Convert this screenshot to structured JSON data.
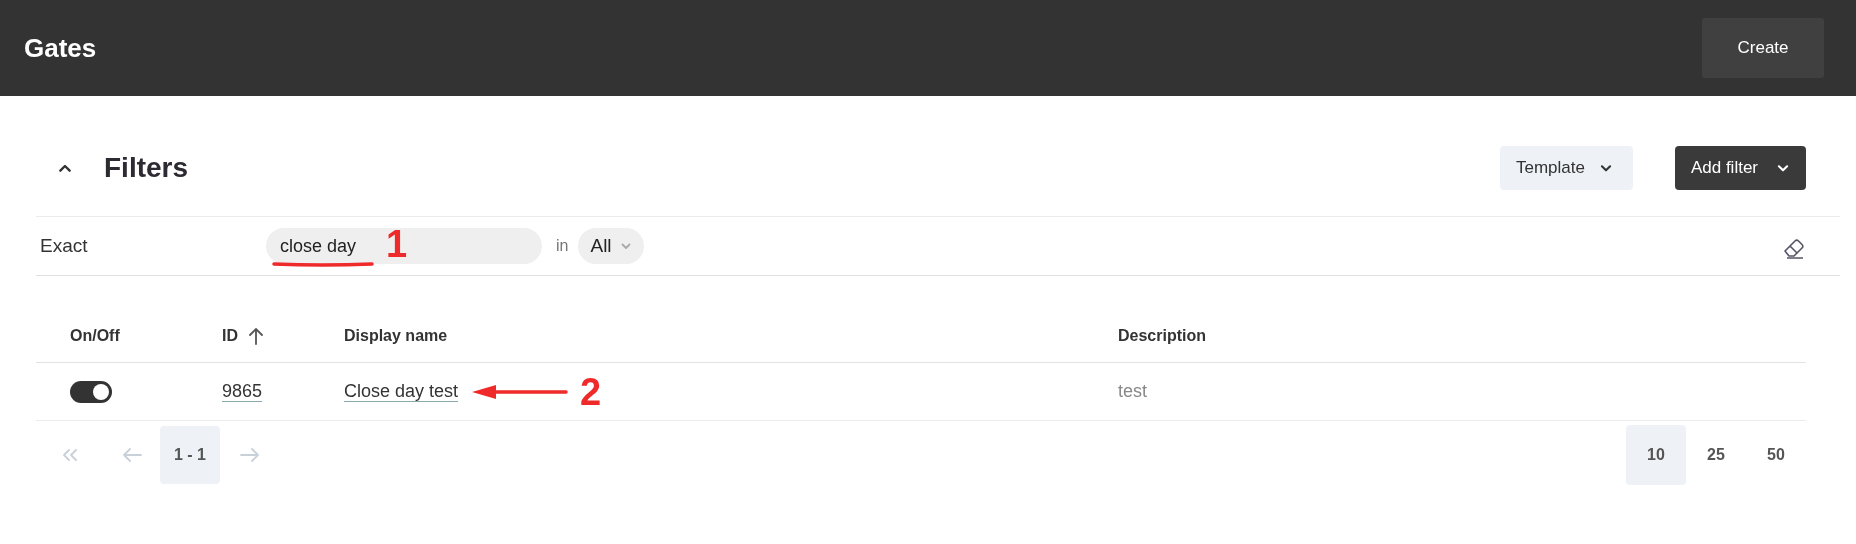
{
  "header": {
    "title": "Gates",
    "create_button": "Create"
  },
  "filters": {
    "title": "Filters",
    "expanded": true,
    "template_button": "Template",
    "add_filter_button": "Add filter",
    "rows": [
      {
        "label": "Exact",
        "value": "close day",
        "in_label": "in",
        "scope": "All"
      }
    ]
  },
  "table": {
    "columns": [
      {
        "label": "On/Off"
      },
      {
        "label": "ID",
        "sorted": true
      },
      {
        "label": "Display name"
      },
      {
        "label": "Description"
      }
    ],
    "rows": [
      {
        "on": true,
        "id": "9865",
        "display_name": "Close day test",
        "description": "test"
      }
    ]
  },
  "pagination": {
    "range": "1 - 1",
    "page_sizes": [
      {
        "label": "10",
        "selected": true
      },
      {
        "label": "25",
        "selected": false
      },
      {
        "label": "50",
        "selected": false
      }
    ]
  },
  "annotations": [
    {
      "kind": "underline",
      "label": "1"
    },
    {
      "kind": "arrow",
      "label": "2"
    }
  ]
}
